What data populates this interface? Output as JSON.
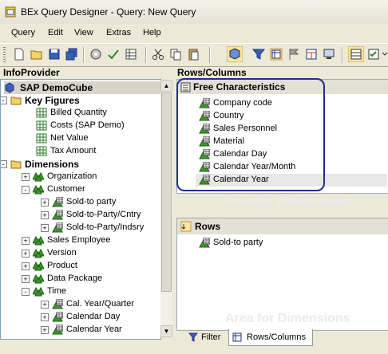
{
  "window": {
    "title": "BEx Query Designer - Query: New Query"
  },
  "menu": [
    "Query",
    "Edit",
    "View",
    "Extras",
    "Help"
  ],
  "toolbar": {
    "icons": [
      "new-icon",
      "open-icon",
      "save-icon",
      "save-all-icon",
      "properties-icon",
      "check-icon",
      "table-icon",
      "cut-icon",
      "copy-icon",
      "paste-icon",
      "cube-icon",
      "filter-icon",
      "rows-columns-icon",
      "flag-icon",
      "layout-icon",
      "save-pc-icon",
      "grid-icon",
      "checklist-icon",
      "more-icon"
    ]
  },
  "left_panel": {
    "header": "InfoProvider",
    "root": "SAP DemoCube",
    "tree": [
      {
        "label": "Key Figures",
        "bold": true
      },
      {
        "label": "Billed Quantity"
      },
      {
        "label": "Costs (SAP Demo)"
      },
      {
        "label": "Net Value"
      },
      {
        "label": "Tax Amount"
      },
      {
        "label": "Dimensions",
        "bold": true
      },
      {
        "label": "Organization"
      },
      {
        "label": "Customer"
      },
      {
        "label": "Sold-to party"
      },
      {
        "label": "Sold-to-Party/Cntry"
      },
      {
        "label": "Sold-to-Party/Indsry"
      },
      {
        "label": "Sales Employee"
      },
      {
        "label": "Version"
      },
      {
        "label": "Product"
      },
      {
        "label": "Data Package"
      },
      {
        "label": "Time"
      },
      {
        "label": "Cal. Year/Quarter"
      },
      {
        "label": "Calendar Day"
      },
      {
        "label": "Calendar Year"
      }
    ]
  },
  "right_panel": {
    "header": "Rows/Columns",
    "free_characteristics": {
      "title": "Free Characteristics",
      "items": [
        "Company code",
        "Country",
        "Sales Personnel",
        "Material",
        "Calendar Day",
        "Calendar Year/Month",
        "Calendar Year"
      ],
      "watermark": "Area for Dimensions"
    },
    "rows": {
      "title": "Rows",
      "items": [
        "Sold-to party"
      ],
      "watermark": "Area for Dimensions"
    }
  },
  "tabs": [
    "Filter",
    "Rows/Columns"
  ],
  "active_tab": "Rows/Columns",
  "colors": {
    "highlight_border": "#1c2f8c",
    "folder": "#f4d36b",
    "characteristic": "#3a9a2a"
  }
}
